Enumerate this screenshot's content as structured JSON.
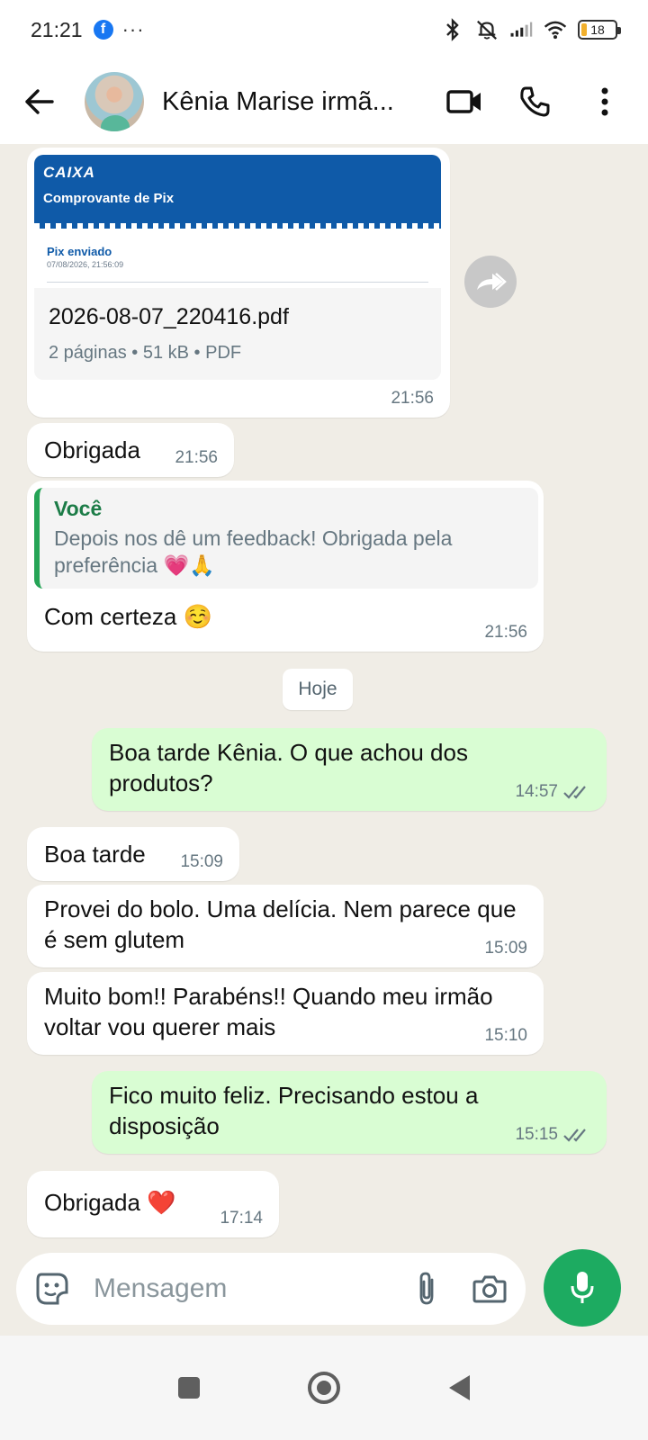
{
  "status": {
    "time": "21:21",
    "battery": "18"
  },
  "contact": {
    "name": "Kênia Marise irmã..."
  },
  "document": {
    "brand": "CAIXA",
    "preview_title": "Comprovante de Pix",
    "preview_status": "Pix enviado",
    "preview_date": "07/08/2026, 21:56:09",
    "file_name": "2026-08-07_220416.pdf",
    "file_info": "2 páginas • 51 kB • PDF",
    "time": "21:56"
  },
  "messages": [
    {
      "text": "Obrigada",
      "time": "21:56"
    },
    {
      "reply_author": "Você",
      "reply_text": "Depois nos dê um feedback! Obrigada pela preferência 💗🙏",
      "text": "Com certeza ☺️",
      "time": "21:56"
    },
    {
      "text": "Boa tarde Kênia. O que achou dos produtos?",
      "time": "14:57"
    },
    {
      "text": "Boa tarde",
      "time": "15:09"
    },
    {
      "text": "Provei do bolo. Uma delícia. Nem parece que é sem glutem",
      "time": "15:09"
    },
    {
      "text": "Muito bom!! Parabéns!! Quando meu irmão voltar vou querer mais",
      "time": "15:10"
    },
    {
      "text": "Fico muito feliz. Precisando estou a disposição",
      "time": "15:15"
    },
    {
      "text": "Obrigada ❤️",
      "time": "17:14"
    }
  ],
  "day_separator": "Hoje",
  "composer": {
    "placeholder": "Mensagem"
  },
  "colors": {
    "outgoing": "#d9fdd3",
    "incoming": "#ffffff",
    "background": "#f0ede6",
    "accent": "#1dab61"
  },
  "icons": [
    "facebook-icon",
    "bluetooth-icon",
    "mute-icon",
    "signal-icon",
    "wifi-icon",
    "battery-icon",
    "back-arrow-icon",
    "video-call-icon",
    "phone-icon",
    "more-vert-icon",
    "forward-icon",
    "double-check-icon",
    "sticker-icon",
    "attach-icon",
    "camera-icon",
    "mic-icon",
    "recents-icon",
    "home-icon",
    "back-icon"
  ]
}
